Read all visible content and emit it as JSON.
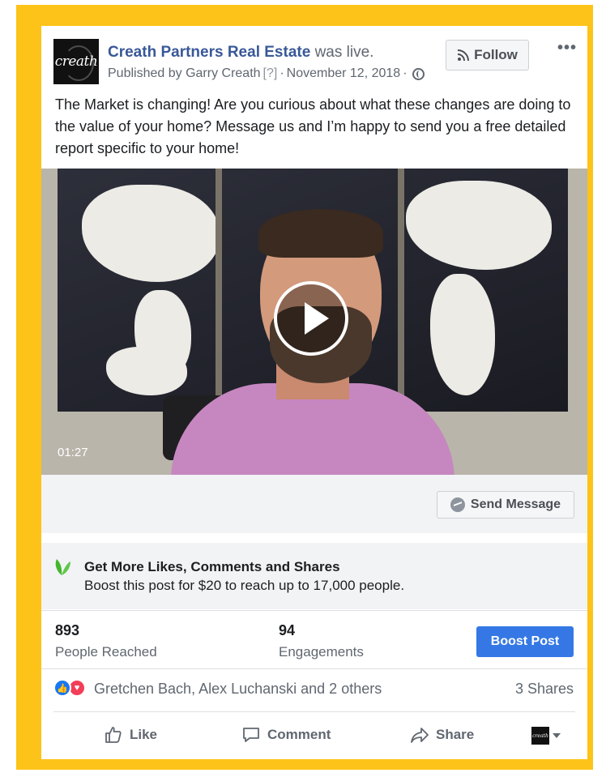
{
  "post": {
    "avatar_text": "creath",
    "page_name": "Creath Partners Real Estate",
    "status": "was live.",
    "published_by": "Published by Garry Creath",
    "help_marker": "[?]",
    "separator": "·",
    "date": "November 12, 2018",
    "follow_label": "Follow",
    "more_label": "•••",
    "text": "The Market is changing! Are you curious about what these changes are doing to the value of your home? Message us and I’m happy to send you a free detailed report specific to your home!"
  },
  "video": {
    "duration": "01:27"
  },
  "message": {
    "send_label": "Send Message"
  },
  "boost": {
    "title": "Get More Likes, Comments and Shares",
    "description": "Boost this post for $20 to reach up to 17,000 people.",
    "button_label": "Boost Post"
  },
  "stats": {
    "reached_value": "893",
    "reached_label": "People Reached",
    "engagements_value": "94",
    "engagements_label": "Engagements"
  },
  "reactions": {
    "names": "Gretchen Bach, Alex Luchanski and 2 others",
    "shares": "3 Shares"
  },
  "actions": {
    "like_label": "Like",
    "comment_label": "Comment",
    "share_label": "Share"
  },
  "colors": {
    "frame": "#fdc318",
    "link": "#385898",
    "primary_button": "#3578e5"
  }
}
